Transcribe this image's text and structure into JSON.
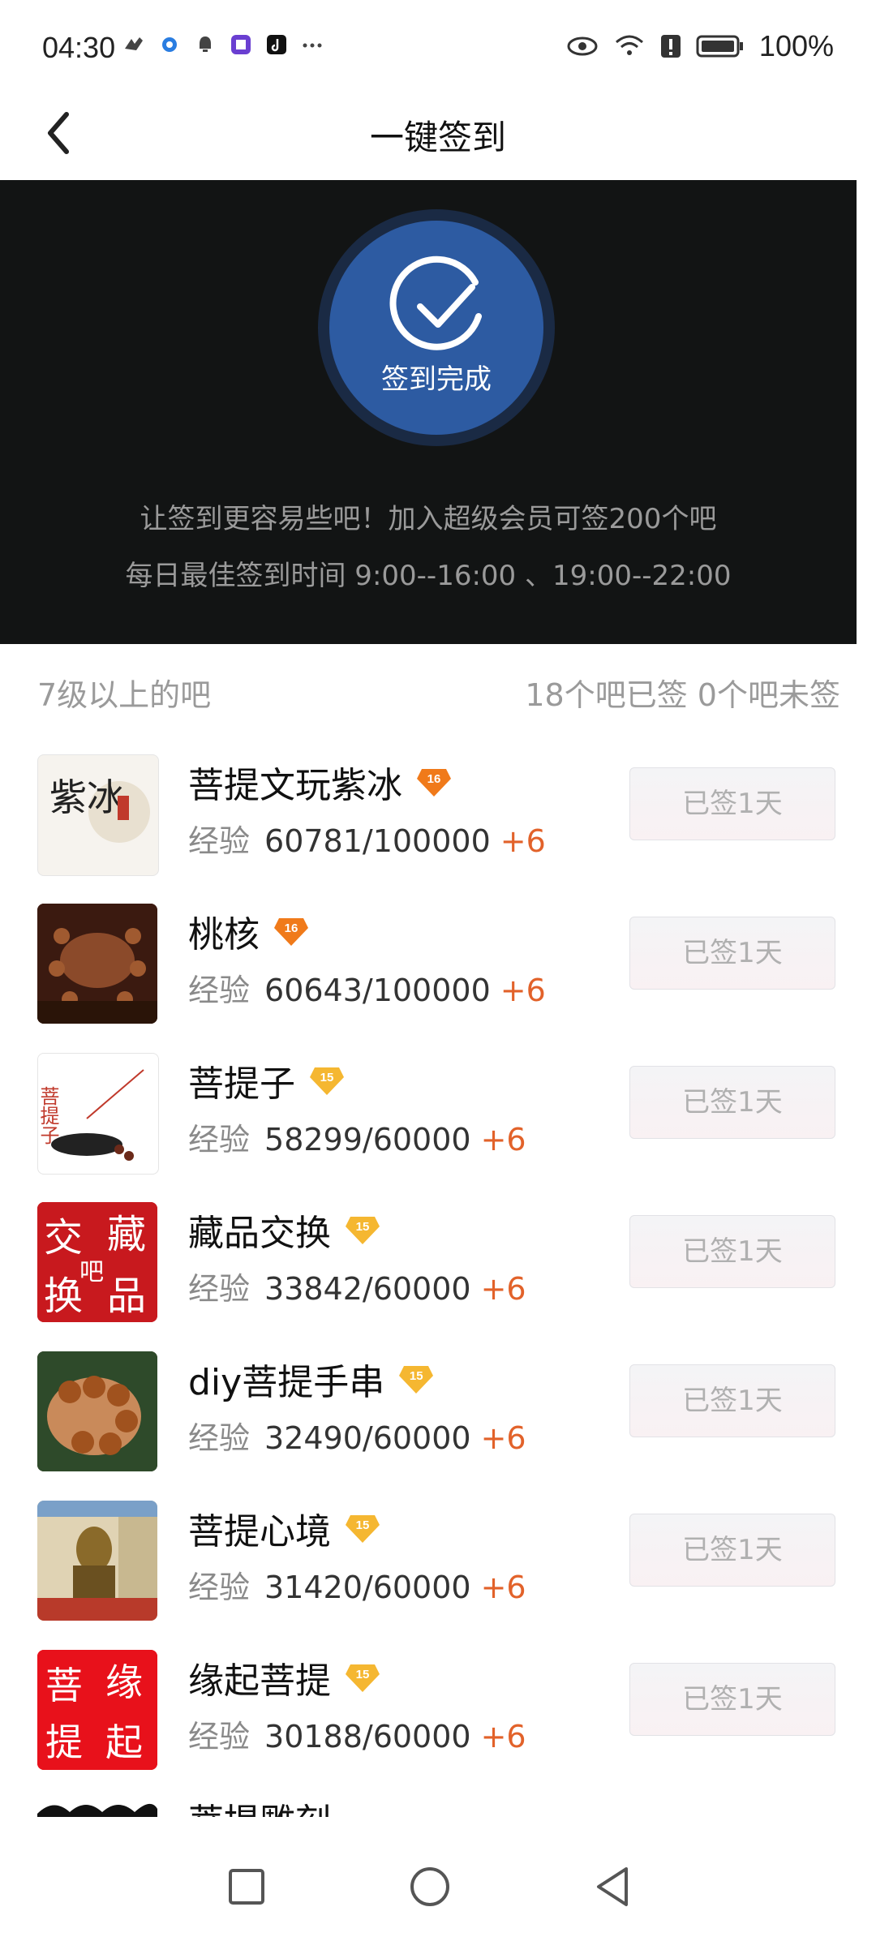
{
  "status_bar": {
    "time": "04:30",
    "battery": "100%"
  },
  "nav": {
    "title": "一键签到"
  },
  "hero": {
    "status": "签到完成",
    "line1": "让签到更容易些吧！加入超级会员可签200个吧",
    "line2": "每日最佳签到时间  9:00--16:00 、19:00--22:00"
  },
  "section": {
    "left": "7级以上的吧",
    "right": "18个吧已签 0个吧未签"
  },
  "list": [
    {
      "name": "菩提文玩紫冰",
      "level": "16",
      "exp_label": "经验",
      "exp": "60781/100000",
      "plus": "+6",
      "button": "已签1天",
      "level_color": "#f07a1a"
    },
    {
      "name": "桃核",
      "level": "16",
      "exp_label": "经验",
      "exp": "60643/100000",
      "plus": "+6",
      "button": "已签1天",
      "level_color": "#f07a1a"
    },
    {
      "name": "菩提子",
      "level": "15",
      "exp_label": "经验",
      "exp": "58299/60000",
      "plus": "+6",
      "button": "已签1天",
      "level_color": "#f5b731"
    },
    {
      "name": "藏品交换",
      "level": "15",
      "exp_label": "经验",
      "exp": "33842/60000",
      "plus": "+6",
      "button": "已签1天",
      "level_color": "#f5b731"
    },
    {
      "name": "diy菩提手串",
      "level": "15",
      "exp_label": "经验",
      "exp": "32490/60000",
      "plus": "+6",
      "button": "已签1天",
      "level_color": "#f5b731"
    },
    {
      "name": "菩提心境",
      "level": "15",
      "exp_label": "经验",
      "exp": "31420/60000",
      "plus": "+6",
      "button": "已签1天",
      "level_color": "#f5b731"
    },
    {
      "name": "缘起菩提",
      "level": "15",
      "exp_label": "经验",
      "exp": "30188/60000",
      "plus": "+6",
      "button": "已签1天",
      "level_color": "#f5b731"
    }
  ],
  "thumb_texts": {
    "t0": "紫冰",
    "t2": "菩提子",
    "t3a": "交",
    "t3b": "藏",
    "t3c": "换",
    "t3d": "品",
    "t3e": "吧",
    "t6a": "菩",
    "t6b": "缘",
    "t6c": "提",
    "t6d": "起"
  },
  "partial_row": {
    "name": "菩提雕刻"
  }
}
